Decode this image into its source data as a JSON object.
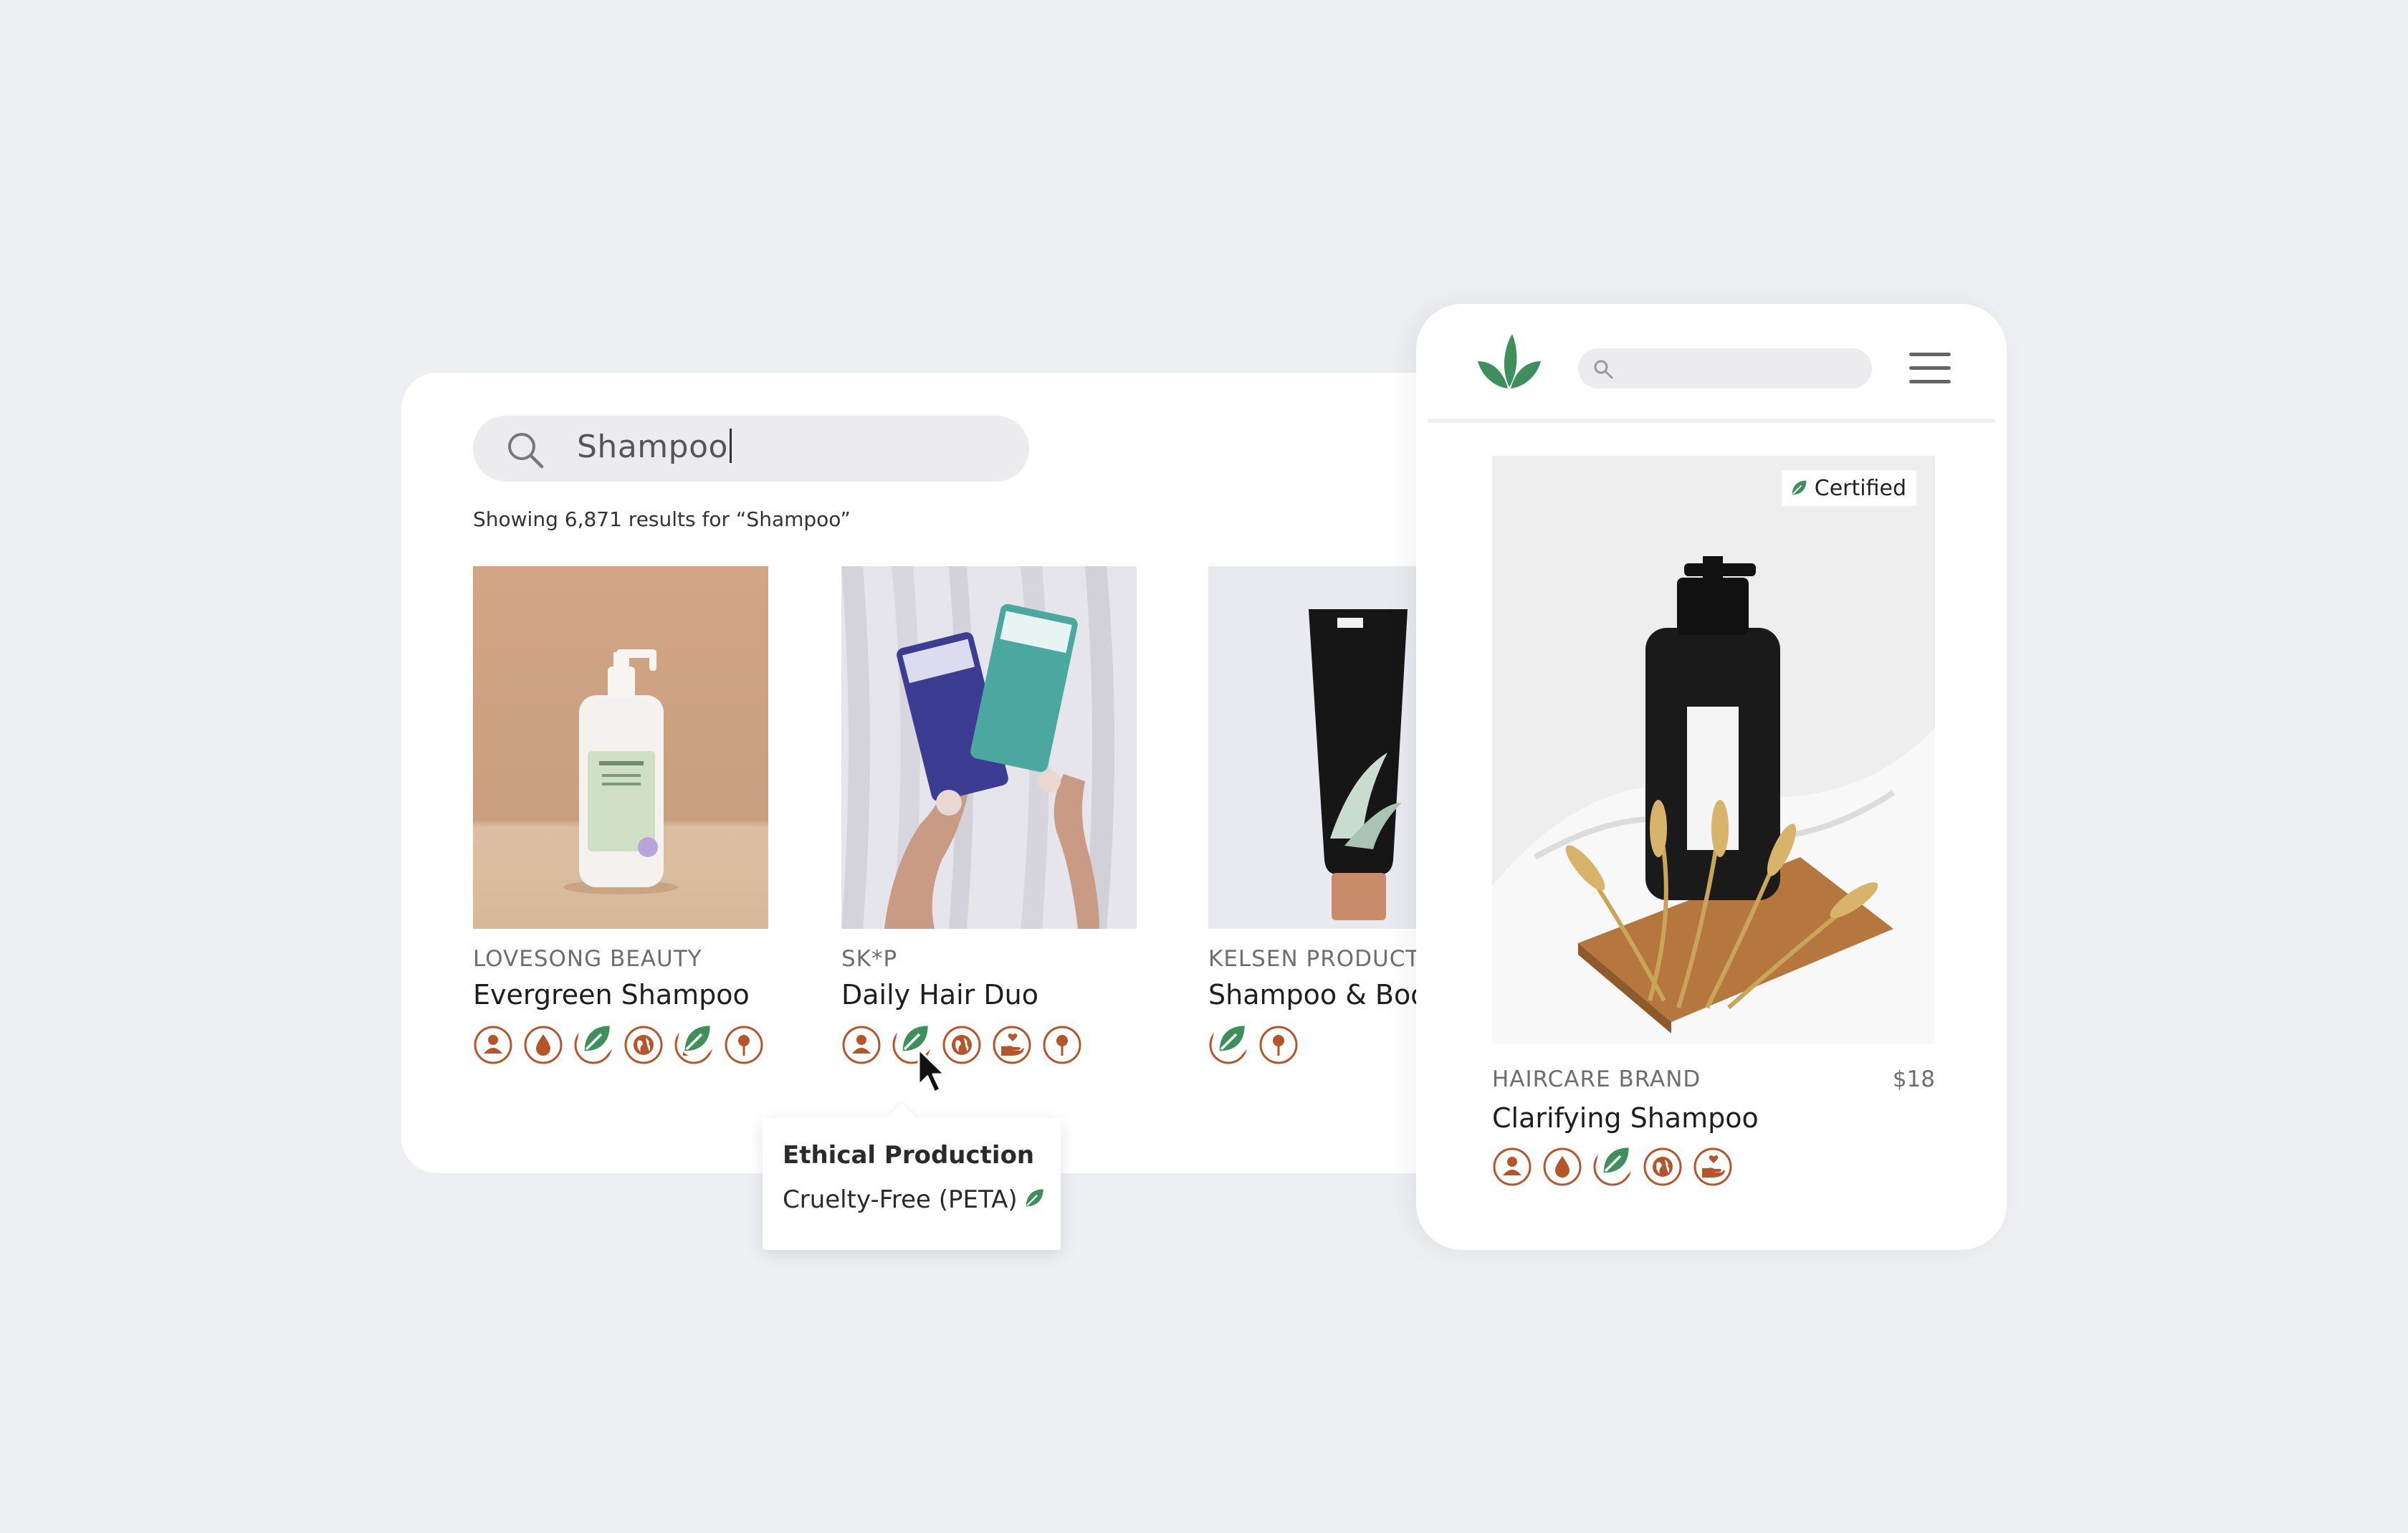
{
  "colors": {
    "background": "#eeeff3",
    "badge_orange": "#b5552b",
    "leaf_green": "#3f8f5c",
    "search_bg": "#ececee"
  },
  "search": {
    "query": "Shampoo",
    "results_text": "Showing 6,871 results for “Shampoo”",
    "icon": "search-icon"
  },
  "products": [
    {
      "brand": "LOVESONG BEAUTY",
      "name": "Evergreen Shampoo",
      "image": "white pump bottle on tan background",
      "badges": [
        {
          "icon": "person-icon",
          "certified": false
        },
        {
          "icon": "drop-icon",
          "certified": false
        },
        {
          "icon": "scale-icon",
          "certified": true
        },
        {
          "icon": "globe-icon",
          "certified": false
        },
        {
          "icon": "hand-heart-icon",
          "certified": true
        },
        {
          "icon": "pin-icon",
          "certified": false
        }
      ]
    },
    {
      "brand": "SK*P",
      "name": "Daily Hair Duo",
      "image": "hands holding two cartons against drapery",
      "badges": [
        {
          "icon": "person-icon",
          "certified": false
        },
        {
          "icon": "scale-icon",
          "certified": true
        },
        {
          "icon": "globe-icon",
          "certified": false
        },
        {
          "icon": "hand-heart-icon",
          "certified": false
        },
        {
          "icon": "pin-icon",
          "certified": false
        }
      ]
    },
    {
      "brand": "KELSEN PRODUCTS",
      "name": "Shampoo & Body Wash",
      "image": "black tube with aloe on light background",
      "badges": [
        {
          "icon": "scale-icon",
          "certified": true
        },
        {
          "icon": "pin-icon",
          "certified": false
        }
      ]
    }
  ],
  "tooltip": {
    "title": "Ethical Production",
    "value": "Cruelty-Free (PETA)"
  },
  "mobile": {
    "logo": "leaf-logo-icon",
    "menu_icon": "hamburger-menu-icon",
    "certified_label": "Certified",
    "product": {
      "brand": "HAIRCARE BRAND",
      "price": "$18",
      "name": "Clarifying Shampoo",
      "image": "black pump bottle on wooden board with wheat",
      "badges": [
        {
          "icon": "person-icon",
          "certified": false
        },
        {
          "icon": "drop-icon",
          "certified": false
        },
        {
          "icon": "scale-icon",
          "certified": true
        },
        {
          "icon": "globe-icon",
          "certified": false
        },
        {
          "icon": "hand-heart-icon",
          "certified": false
        }
      ]
    }
  }
}
